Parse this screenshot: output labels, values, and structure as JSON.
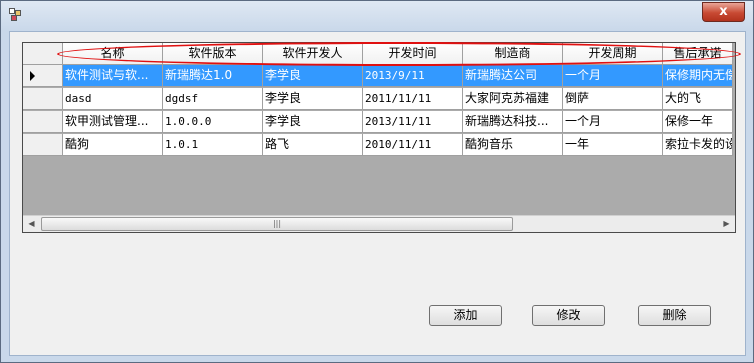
{
  "window": {
    "close_label": "x"
  },
  "grid": {
    "columns": [
      "名称",
      "软件版本",
      "软件开发人",
      "开发时间",
      "制造商",
      "开发周期",
      "售后承诺"
    ],
    "rows": [
      [
        "软件测试与软...",
        "新瑞腾达1.0",
        "李学良",
        "2013/9/11",
        "新瑞腾达公司",
        "一个月",
        "保修期内无偿"
      ],
      [
        "dasd",
        "dgdsf",
        "李学良",
        "2011/11/11",
        "大家阿克苏福建",
        "倒萨",
        "大的飞"
      ],
      [
        "软甲测试管理...",
        "1.0.0.0",
        "李学良",
        "2013/11/11",
        "新瑞腾达科技...",
        "一个月",
        "保修一年"
      ],
      [
        "酷狗",
        "1.0.1",
        "路飞",
        "2010/11/11",
        "酷狗音乐",
        "一年",
        "索拉卡发的设"
      ]
    ],
    "selected_row": 0,
    "scroll_thumb_grip": "|||"
  },
  "buttons": {
    "add": "添加",
    "edit": "修改",
    "delete": "删除"
  },
  "colors": {
    "selection": "#3399ff",
    "annotation": "#e01010",
    "grid_background": "#ababab"
  }
}
